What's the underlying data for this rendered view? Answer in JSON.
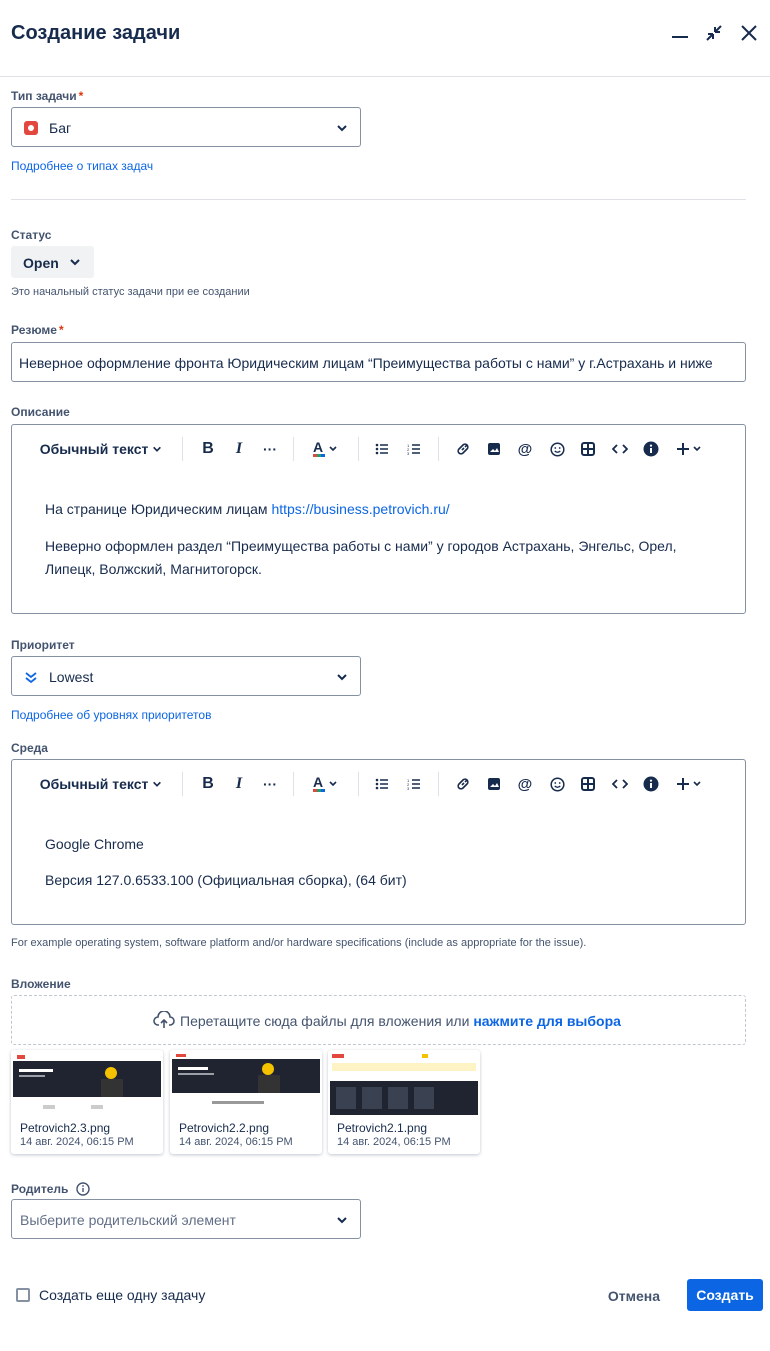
{
  "dialog": {
    "title": "Создание задачи"
  },
  "issue_type": {
    "label": "Тип задачи",
    "required_mark": "*",
    "value": "Баг",
    "icon": "bug-icon",
    "help_link": "Подробнее о типах задач"
  },
  "status": {
    "label": "Статус",
    "value": "Open",
    "hint": "Это начальный статус задачи при ее создании"
  },
  "summary": {
    "label": "Резюме",
    "required_mark": "*",
    "value": "Неверное оформление фронта Юридическим лицам “Преимущества работы с нами” у г.Астрахань и ниже"
  },
  "description": {
    "label": "Описание",
    "toolbar": {
      "text_style": "Обычный текст"
    },
    "para1_text": "На странице Юридическим лицам ",
    "para1_link": "https://business.petrovich.ru/",
    "para2_line1": "Неверно оформлен раздел “Преимущества работы с нами” у городов Астрахань, Энгельс, Орел,",
    "para2_line2": "Липецк, Волжский, Магнитогорск."
  },
  "priority": {
    "label": "Приоритет",
    "value": "Lowest",
    "icon": "priority-lowest-icon",
    "help_link": "Подробнее об уровнях приоритетов"
  },
  "environment": {
    "label": "Среда",
    "toolbar": {
      "text_style": "Обычный текст"
    },
    "line1": "Google Chrome",
    "line2": "Версия 127.0.6533.100 (Официальная сборка), (64 бит)",
    "hint": "For example operating system, software platform and/or hardware specifications (include as appropriate for the issue)."
  },
  "attachment": {
    "label": "Вложение",
    "drop_text": "Перетащите сюда файлы для вложения или ",
    "drop_link": "нажмите для выбора",
    "files": [
      {
        "name": "Petrovich2.3.png",
        "date": "14 авг. 2024, 06:15 PM"
      },
      {
        "name": "Petrovich2.2.png",
        "date": "14 авг. 2024, 06:15 PM"
      },
      {
        "name": "Petrovich2.1.png",
        "date": "14 авг. 2024, 06:15 PM"
      }
    ]
  },
  "parent": {
    "label": "Родитель",
    "placeholder": "Выберите родительский элемент"
  },
  "footer": {
    "create_another": "Создать еще одну задачу",
    "cancel": "Отмена",
    "create": "Создать"
  },
  "colors": {
    "accent": "#0c66e4",
    "bug": "#e2483d",
    "required": "#de350b"
  }
}
